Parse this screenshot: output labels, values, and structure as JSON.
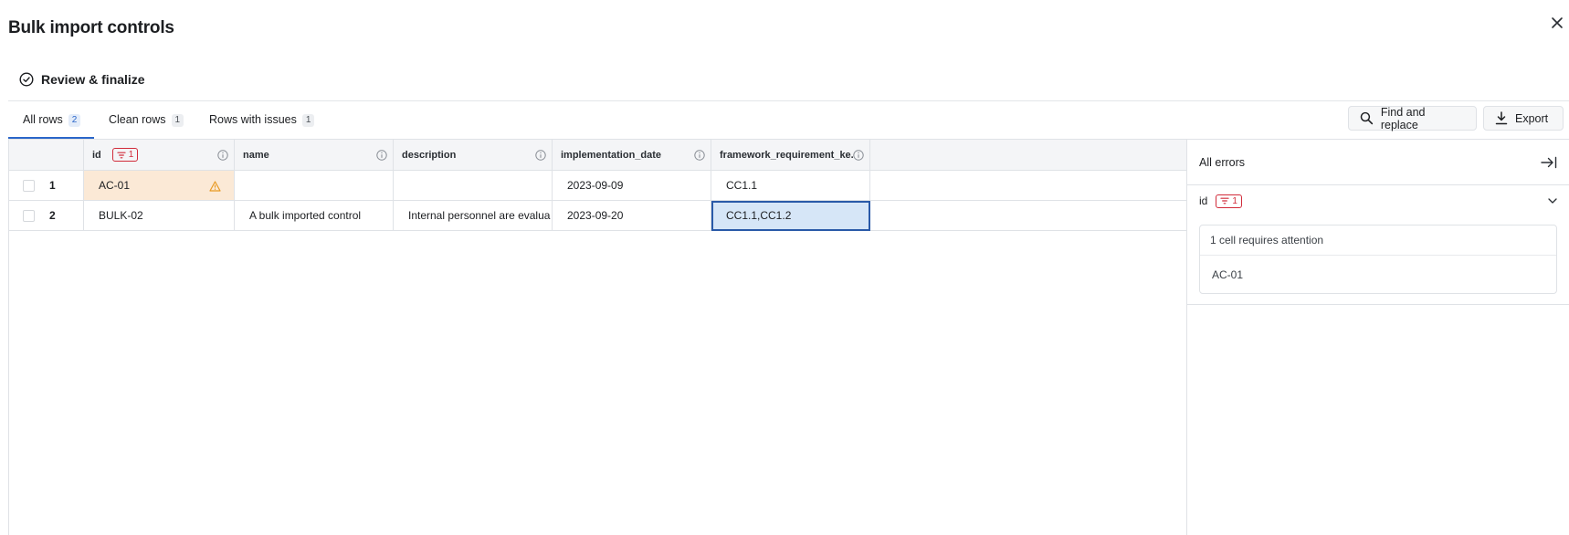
{
  "dialog": {
    "title": "Bulk import controls",
    "step_label": "Review & finalize"
  },
  "tabs": [
    {
      "label": "All rows",
      "count": "2",
      "active": true
    },
    {
      "label": "Clean rows",
      "count": "1",
      "active": false
    },
    {
      "label": "Rows with issues",
      "count": "1",
      "active": false
    }
  ],
  "toolbar": {
    "find_replace_label": "Find and replace",
    "export_label": "Export"
  },
  "table": {
    "columns": [
      "id",
      "name",
      "description",
      "implementation_date",
      "framework_requirement_ke..."
    ],
    "id_filter_count": "1",
    "rows": [
      {
        "num": "1",
        "id": "AC-01",
        "name": "",
        "description": "",
        "implementation_date": "2023-09-09",
        "framework_requirement_keys": "CC1.1"
      },
      {
        "num": "2",
        "id": "BULK-02",
        "name": "A bulk imported control",
        "description": "Internal personnel are evalua",
        "implementation_date": "2023-09-20",
        "framework_requirement_keys": "CC1.1,CC1.2"
      }
    ]
  },
  "errors_panel": {
    "title": "All errors",
    "group_label": "id",
    "group_count": "1",
    "card_heading": "1 cell requires attention",
    "card_items": [
      "AC-01"
    ]
  },
  "colors": {
    "accent": "#2a66c9",
    "error": "#d12b3a",
    "warning": "#e89a24",
    "warning_cell_bg": "#fbe9d6",
    "selected_cell_bg": "#d6e6f7"
  },
  "icons": {
    "close": "close-icon",
    "step": "check-circle-icon",
    "find": "search-icon",
    "export": "download-icon",
    "info": "info-icon",
    "warning": "warning-icon",
    "filter": "filter-icon",
    "collapse_panel": "collapse-right-icon",
    "group_toggle": "chevron-down-icon"
  }
}
